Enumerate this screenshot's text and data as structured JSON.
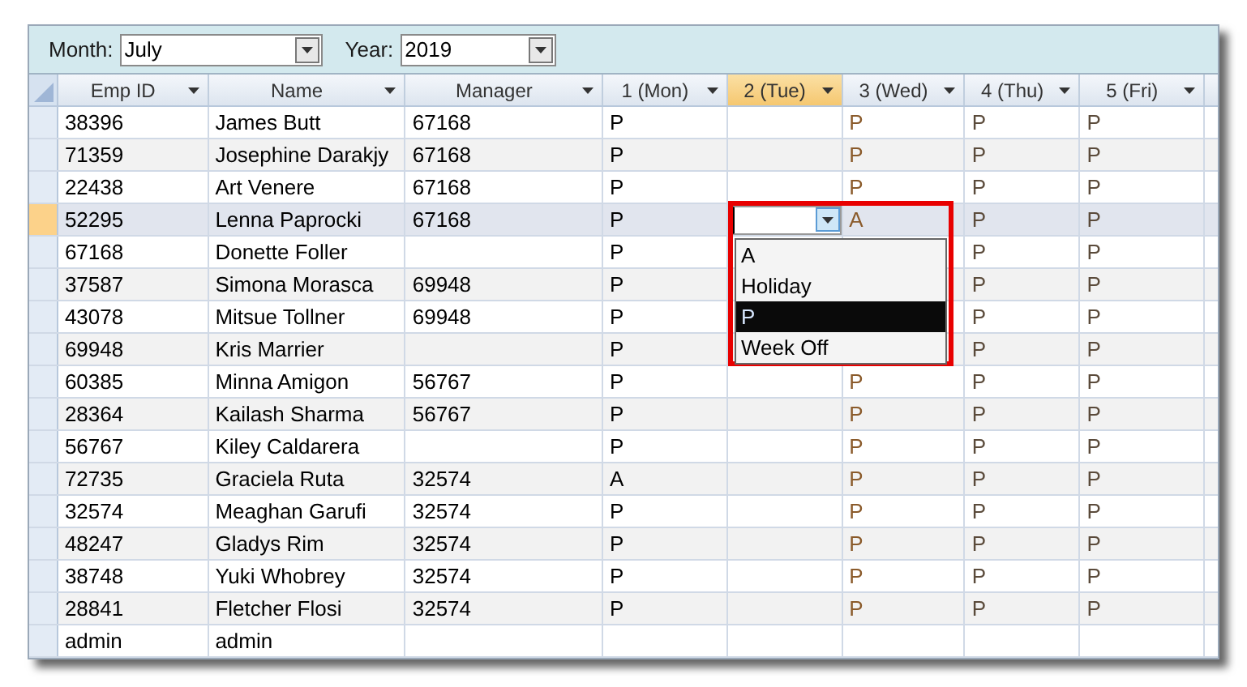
{
  "filters": [
    {
      "label": "Month:",
      "value": "July"
    },
    {
      "label": "Year:",
      "value": "2019"
    }
  ],
  "columns": [
    {
      "header": "Emp ID",
      "selected": false
    },
    {
      "header": "Name",
      "selected": false
    },
    {
      "header": "Manager",
      "selected": false
    },
    {
      "header": "1 (Mon)",
      "selected": false
    },
    {
      "header": "2 (Tue)",
      "selected": true
    },
    {
      "header": "3 (Wed)",
      "selected": false
    },
    {
      "header": "4 (Thu)",
      "selected": false
    },
    {
      "header": "5 (Fri)",
      "selected": false
    }
  ],
  "rows": [
    {
      "selected": false,
      "cells": [
        "38396",
        "James Butt",
        "67168",
        "P",
        null,
        "P",
        "P",
        "P"
      ]
    },
    {
      "selected": false,
      "cells": [
        "71359",
        "Josephine Darakjy",
        "67168",
        "P",
        null,
        "P",
        "P",
        "P"
      ]
    },
    {
      "selected": false,
      "cells": [
        "22438",
        "Art Venere",
        "67168",
        "P",
        null,
        "P",
        "P",
        "P"
      ]
    },
    {
      "selected": true,
      "cells": [
        "52295",
        "Lenna Paprocki",
        "67168",
        "P",
        null,
        "A",
        "P",
        "P"
      ],
      "editor": {
        "options": [
          {
            "label": "A",
            "selected": false
          },
          {
            "label": "Holiday",
            "selected": false
          },
          {
            "label": "P",
            "selected": true
          },
          {
            "label": "Week Off",
            "selected": false
          }
        ]
      }
    },
    {
      "selected": false,
      "cells": [
        "67168",
        "Donette Foller",
        null,
        "P",
        null,
        null,
        "P",
        "P"
      ]
    },
    {
      "selected": false,
      "cells": [
        "37587",
        "Simona Morasca",
        "69948",
        "P",
        null,
        null,
        "P",
        "P"
      ]
    },
    {
      "selected": false,
      "cells": [
        "43078",
        "Mitsue Tollner",
        "69948",
        "P",
        null,
        null,
        "P",
        "P"
      ]
    },
    {
      "selected": false,
      "cells": [
        "69948",
        "Kris Marrier",
        null,
        "P",
        null,
        null,
        "P",
        "P"
      ]
    },
    {
      "selected": false,
      "cells": [
        "60385",
        "Minna Amigon",
        "56767",
        "P",
        null,
        "P",
        "P",
        "P"
      ]
    },
    {
      "selected": false,
      "cells": [
        "28364",
        "Kailash Sharma",
        "56767",
        "P",
        null,
        "P",
        "P",
        "P"
      ]
    },
    {
      "selected": false,
      "cells": [
        "56767",
        "Kiley Caldarera",
        null,
        "P",
        null,
        "P",
        "P",
        "P"
      ]
    },
    {
      "selected": false,
      "cells": [
        "72735",
        "Graciela Ruta",
        "32574",
        "A",
        null,
        "P",
        "P",
        "P"
      ]
    },
    {
      "selected": false,
      "cells": [
        "32574",
        "Meaghan Garufi",
        "32574",
        "P",
        null,
        "P",
        "P",
        "P"
      ]
    },
    {
      "selected": false,
      "cells": [
        "48247",
        "Gladys Rim",
        "32574",
        "P",
        null,
        "P",
        "P",
        "P"
      ]
    },
    {
      "selected": false,
      "cells": [
        "38748",
        "Yuki Whobrey",
        "32574",
        "P",
        null,
        "P",
        "P",
        "P"
      ]
    },
    {
      "selected": false,
      "cells": [
        "28841",
        "Fletcher Flosi",
        "32574",
        "P",
        null,
        "P",
        "P",
        "P"
      ]
    },
    {
      "selected": false,
      "cells": [
        "admin",
        "admin",
        null,
        null,
        null,
        null,
        null,
        null
      ]
    }
  ]
}
